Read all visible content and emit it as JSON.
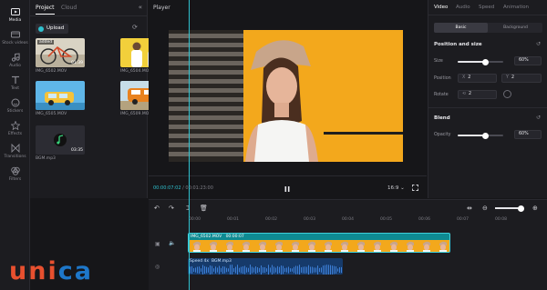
{
  "rail": [
    {
      "label": "Media",
      "icon": "media-icon",
      "active": true
    },
    {
      "label": "Stock videos",
      "icon": "stock-videos-icon"
    },
    {
      "label": "Audio",
      "icon": "audio-icon"
    },
    {
      "label": "Text",
      "icon": "text-icon"
    },
    {
      "label": "Stickers",
      "icon": "stickers-icon"
    },
    {
      "label": "Effects",
      "icon": "effects-icon"
    },
    {
      "label": "Transitions",
      "icon": "transitions-icon"
    },
    {
      "label": "Filters",
      "icon": "filters-icon"
    }
  ],
  "media": {
    "tabs": [
      "Project",
      "Cloud"
    ],
    "upload_label": "Upload",
    "items": [
      {
        "name": "IMG_6502.MOV",
        "duration": "01:39",
        "badge": "added"
      },
      {
        "name": "IMG_6504.MOV",
        "duration": "01:39",
        "badge": ""
      },
      {
        "name": "IMG_6505.MOV",
        "duration": "",
        "badge": ""
      },
      {
        "name": "IMG_6509.MOV",
        "duration": "",
        "badge": ""
      },
      {
        "name": "BGM.mp3",
        "duration": "03:35",
        "badge": ""
      }
    ]
  },
  "player": {
    "title": "Player",
    "current_time": "00:00:07:02",
    "separator": " / ",
    "total_time": "00:01:23:00",
    "aspect_ratio": "16:9"
  },
  "properties": {
    "tabs": [
      "Video",
      "Audio",
      "Speed",
      "Animation"
    ],
    "segments": [
      "Basic",
      "Background"
    ],
    "position_section": "Position and size",
    "size_label": "Size",
    "size_value": "60%",
    "size_level": 0.6,
    "position_label": "Position",
    "position_x_axis": "X",
    "position_x": "2",
    "position_y_axis": "Y",
    "position_y": "2",
    "rotate_label": "Rotate",
    "rotate_value": "2",
    "blend_section": "Blend",
    "opacity_label": "Opacity",
    "opacity_value": "60%",
    "opacity_level": 0.6
  },
  "timeline": {
    "ruler": [
      "00:00",
      "00:01",
      "00:02",
      "00:03",
      "00:04",
      "00:05",
      "00:06",
      "00:07",
      "00:08"
    ],
    "video_clip": {
      "name": "IMG_6502.MOV",
      "time": "00:00:07"
    },
    "audio_clip": {
      "speed": "Speed 4x",
      "name": "BGM.mp3"
    }
  },
  "logo": {
    "part1": "uni",
    "part2": "ca"
  },
  "colors": {
    "accent": "#2fc1cf",
    "video_clip": "#0e8a92",
    "audio_clip": "#163a6a",
    "logo_red": "#e8502f",
    "logo_blue": "#1e77c9"
  }
}
